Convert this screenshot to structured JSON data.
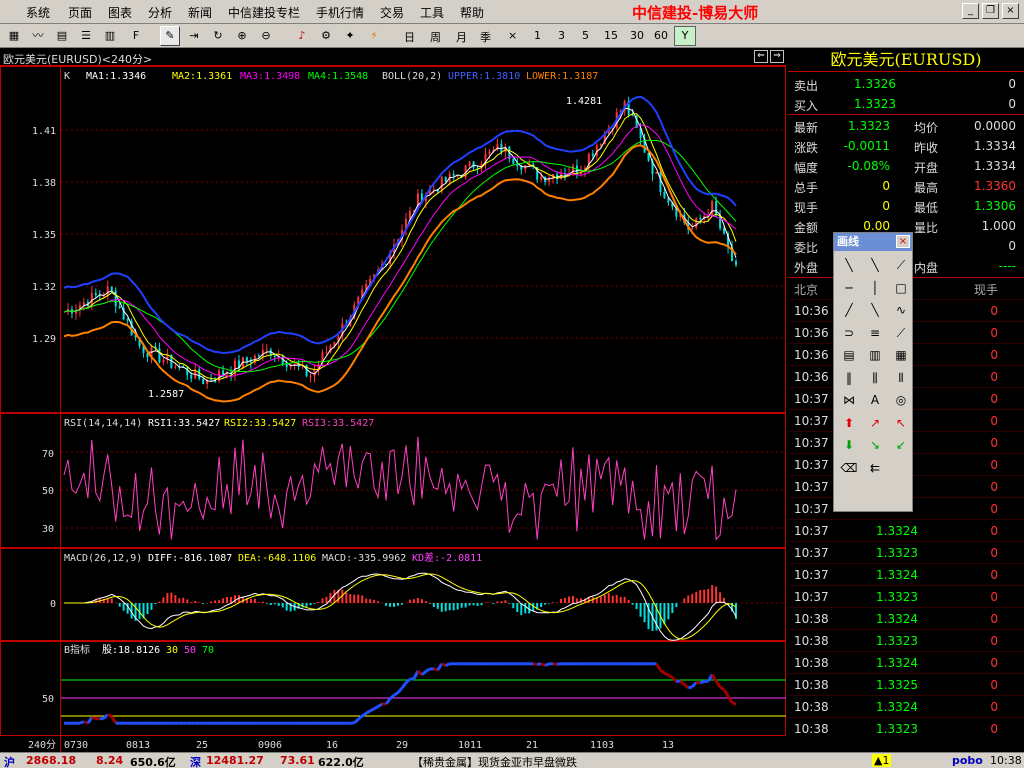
{
  "menu": {
    "items": [
      "系统",
      "页面",
      "图表",
      "分析",
      "新闻",
      "中信建投专栏",
      "手机行情",
      "交易",
      "工具",
      "帮助"
    ],
    "brand": "中信建投-博易大师"
  },
  "toolbar": {
    "periods": [
      "日",
      "周",
      "月",
      "季",
      "×",
      "1",
      "3",
      "5",
      "15",
      "30",
      "60"
    ],
    "y_label": "Y"
  },
  "chart": {
    "header": "欧元美元(EURUSD)<240分>",
    "kline_legend": {
      "k": "K",
      "ma1": "MA1:1.3346",
      "ma2": "MA2:1.3361",
      "ma3": "MA3:1.3498",
      "ma4": "MA4:1.3548",
      "boll": "BOLL(20,2)",
      "upper": "UPPER:1.3810",
      "lower": "LOWER:1.3187"
    },
    "price_ticks": [
      "1.41",
      "1.38",
      "1.35",
      "1.32",
      "1.29"
    ],
    "high_label": "1.4281",
    "low_label": "1.2587",
    "rsi_legend": {
      "name": "RSI(14,14,14)",
      "rsi1": "RSI1:33.5427",
      "rsi2": "RSI2:33.5427",
      "rsi3": "RSI3:33.5427"
    },
    "rsi_ticks": [
      "70",
      "50",
      "30"
    ],
    "macd_legend": {
      "name": "MACD(26,12,9)",
      "diff": "DIFF:-816.1087",
      "dea": "DEA:-648.1106",
      "macd": "MACD:-335.9962",
      "kd": "KD差:-2.0811"
    },
    "macd_tick": "0",
    "bottom_legend": {
      "name": "B指标",
      "gu": "股:18.8126",
      "l30": "30",
      "l50": "50",
      "l70": "70"
    },
    "bottom_tick": "50",
    "x_period": "240分",
    "x_ticks": [
      "0730",
      "0813",
      "25",
      "0906",
      "16",
      "29",
      "1011",
      "21",
      "1103",
      "13"
    ]
  },
  "quote": {
    "title": "欧元美元(EURUSD)",
    "sell": {
      "label": "卖出",
      "price": "1.3326",
      "vol": "0"
    },
    "buy": {
      "label": "买入",
      "price": "1.3323",
      "vol": "0"
    },
    "stats": [
      {
        "l1": "最新",
        "v1": "1.3323",
        "l2": "均价",
        "v2": "0.0000"
      },
      {
        "l1": "涨跌",
        "v1": "-0.0011",
        "l2": "昨收",
        "v2": "1.3334"
      },
      {
        "l1": "幅度",
        "v1": "-0.08%",
        "l2": "开盘",
        "v2": "1.3334"
      },
      {
        "l1": "总手",
        "v1": "0",
        "l2": "最高",
        "v2": "1.3360"
      },
      {
        "l1": "现手",
        "v1": "0",
        "l2": "最低",
        "v2": "1.3306"
      },
      {
        "l1": "金额",
        "v1": "0.00",
        "l2": "量比",
        "v2": "1.000"
      }
    ],
    "weibi": {
      "label": "委比",
      "value": "0"
    },
    "waipan": {
      "label": "外盘",
      "label2": "内盘",
      "value2": "----"
    },
    "tick_header": {
      "time": "北京",
      "vol": "现手"
    },
    "ticks": [
      {
        "time": "10:36",
        "price": "",
        "vol": "0"
      },
      {
        "time": "10:36",
        "price": "",
        "vol": "0"
      },
      {
        "time": "10:36",
        "price": "",
        "vol": "0"
      },
      {
        "time": "10:36",
        "price": "",
        "vol": "0"
      },
      {
        "time": "10:37",
        "price": "",
        "vol": "0"
      },
      {
        "time": "10:37",
        "price": "",
        "vol": "0"
      },
      {
        "time": "10:37",
        "price": "",
        "vol": "0"
      },
      {
        "time": "10:37",
        "price": "",
        "vol": "0"
      },
      {
        "time": "10:37",
        "price": "",
        "vol": "0"
      },
      {
        "time": "10:37",
        "price": "",
        "vol": "0"
      },
      {
        "time": "10:37",
        "price": "1.3324",
        "vol": "0"
      },
      {
        "time": "10:37",
        "price": "1.3323",
        "vol": "0"
      },
      {
        "time": "10:37",
        "price": "1.3324",
        "vol": "0"
      },
      {
        "time": "10:37",
        "price": "1.3323",
        "vol": "0"
      },
      {
        "time": "10:38",
        "price": "1.3324",
        "vol": "0"
      },
      {
        "time": "10:38",
        "price": "1.3323",
        "vol": "0"
      },
      {
        "time": "10:38",
        "price": "1.3324",
        "vol": "0"
      },
      {
        "time": "10:38",
        "price": "1.3325",
        "vol": "0"
      },
      {
        "time": "10:38",
        "price": "1.3324",
        "vol": "0"
      },
      {
        "time": "10:38",
        "price": "1.3323",
        "vol": "0"
      }
    ]
  },
  "drawing_panel": {
    "title": "画线"
  },
  "status": {
    "sh_label": "沪",
    "sh_index": "2868.18",
    "sh_chg": "8.24",
    "sh_amt": "650.6亿",
    "sz_label": "深",
    "sz_index": "12481.27",
    "sz_chg": "73.61",
    "sz_amt": "622.0亿",
    "news": "【稀贵金属】现货金亚市早盘微跌",
    "alert": "▲1",
    "logo": "pobo",
    "time": "10:38"
  },
  "colors": {
    "bg": "#000000",
    "grid": "#800000",
    "up": "#ff3333",
    "down": "#00e0e0",
    "ma1": "#ffffff",
    "ma2": "#ffff00",
    "ma3": "#ff00ff",
    "ma4": "#00ff00",
    "upper": "#2040ff",
    "lower": "#ff8000",
    "rsi": "#ff40c0"
  }
}
